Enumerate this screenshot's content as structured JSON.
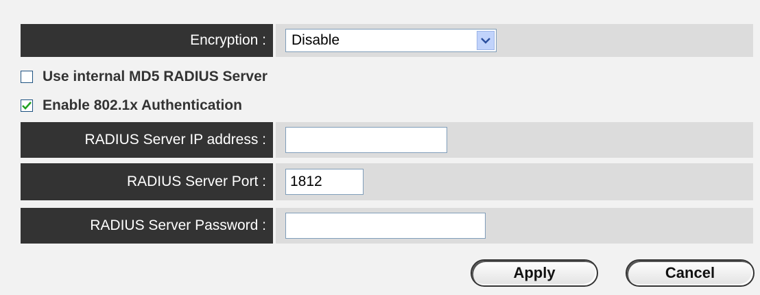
{
  "encryption": {
    "label": "Encryption :",
    "selected": "Disable"
  },
  "options": {
    "use_internal_md5": {
      "label": "Use internal MD5 RADIUS Server",
      "checked": false
    },
    "enable_8021x": {
      "label": "Enable 802.1x Authentication",
      "checked": true
    }
  },
  "radius": {
    "ip_label": "RADIUS Server IP address :",
    "ip_value": "",
    "port_label": "RADIUS Server Port :",
    "port_value": "1812",
    "password_label": "RADIUS Server Password :",
    "password_value": ""
  },
  "actions": {
    "apply_label": "Apply",
    "cancel_label": "Cancel"
  },
  "colors": {
    "label_bg": "#333333",
    "value_bg": "#dcdcdc",
    "page_bg": "#f2f2f2",
    "check_green": "#21a121"
  }
}
